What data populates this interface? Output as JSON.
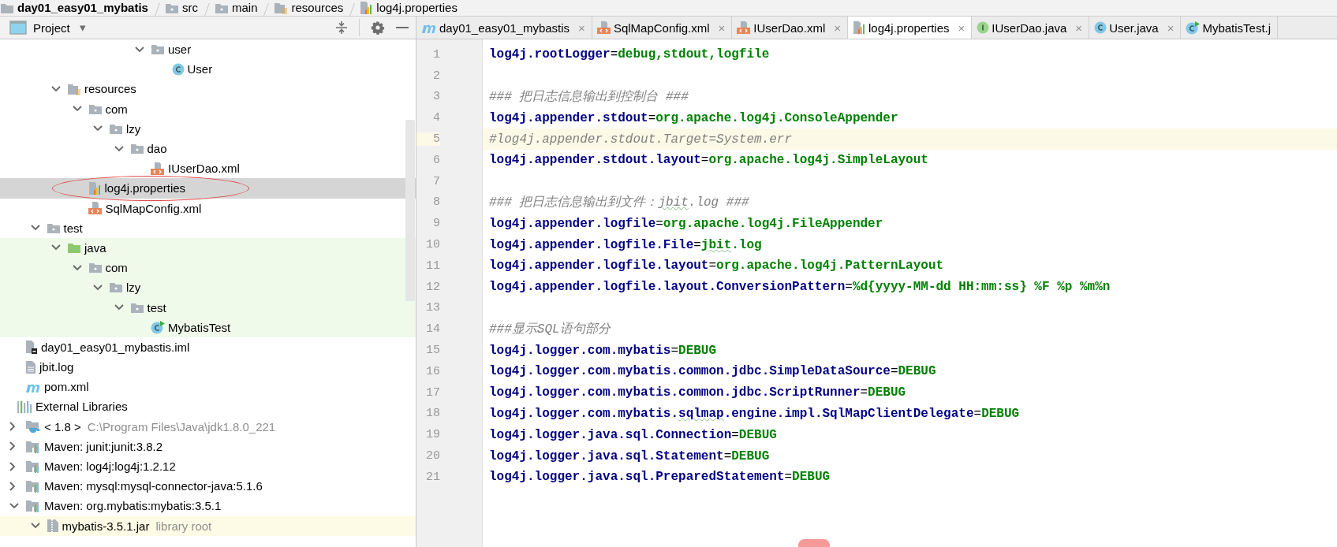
{
  "breadcrumb": [
    {
      "label": "day01_easy01_mybatis",
      "kind": "project"
    },
    {
      "label": "src",
      "kind": "folder"
    },
    {
      "label": "main",
      "kind": "folder"
    },
    {
      "label": "resources",
      "kind": "resource-folder"
    },
    {
      "label": "log4j.properties",
      "kind": "properties"
    }
  ],
  "project_panel": {
    "title": "Project",
    "caret": "▾",
    "tree": [
      {
        "children": [
          {
            "children": [
              {
                "children": [
                  {
                    "children": [
                      {
                        "children": [
                          {
                            "children": [
                              {
                                "children": [
                                  {
                                    "label": "user",
                                    "kind": "folder",
                                    "expanded": true,
                                    "selected": false,
                                    "children": [
                                      {
                                        "label": "User",
                                        "kind": "class",
                                        "selected": false
                                      }
                                    ]
                                  }
                                ]
                              }
                            ]
                          }
                        ]
                      }
                    ]
                  },
                  {
                    "label": "resources",
                    "kind": "resource-folder",
                    "expanded": true,
                    "selected": false,
                    "children": [
                      {
                        "label": "com",
                        "kind": "folder",
                        "expanded": true,
                        "selected": false,
                        "children": [
                          {
                            "label": "lzy",
                            "kind": "folder",
                            "expanded": true,
                            "selected": false,
                            "children": [
                              {
                                "label": "dao",
                                "kind": "folder",
                                "expanded": true,
                                "selected": false,
                                "children": [
                                  {
                                    "label": "IUserDao.xml",
                                    "kind": "xml",
                                    "selected": false
                                  }
                                ]
                              }
                            ]
                          }
                        ]
                      },
                      {
                        "label": "log4j.properties",
                        "kind": "properties",
                        "selected": true,
                        "circled": true
                      },
                      {
                        "label": "SqlMapConfig.xml",
                        "kind": "xml",
                        "selected": false
                      }
                    ]
                  }
                ]
              },
              {
                "label": "test",
                "kind": "folder",
                "expanded": true,
                "selected": false,
                "children": [
                  {
                    "label": "java",
                    "kind": "test-folder",
                    "test_scope": true,
                    "expanded": true,
                    "selected": false,
                    "children": [
                      {
                        "label": "com",
                        "kind": "folder",
                        "expanded": true,
                        "selected": false,
                        "children": [
                          {
                            "label": "lzy",
                            "kind": "folder",
                            "expanded": true,
                            "selected": false,
                            "children": [
                              {
                                "label": "test",
                                "kind": "folder",
                                "expanded": true,
                                "selected": false,
                                "children": [
                                  {
                                    "label": "MybatisTest",
                                    "kind": "test-class",
                                    "selected": false
                                  }
                                ]
                              }
                            ]
                          }
                        ]
                      }
                    ]
                  }
                ]
              }
            ]
          },
          {
            "label": "day01_easy01_mybastis.iml",
            "kind": "iml",
            "selected": false
          },
          {
            "label": "jbit.log",
            "kind": "log",
            "selected": false
          },
          {
            "label": "pom.xml",
            "kind": "maven",
            "selected": false
          }
        ]
      },
      {
        "label": "External Libraries",
        "kind": "libraries",
        "selected": false,
        "children": [
          {
            "label": "< 1.8 >",
            "detail": "C:\\Program Files\\Java\\jdk1.8.0_221",
            "kind": "jdk",
            "expanded": false,
            "selected": false
          },
          {
            "label": "Maven: junit:junit:3.8.2",
            "kind": "maven-library",
            "expanded": false,
            "selected": false
          },
          {
            "label": "Maven: log4j:log4j:1.2.12",
            "kind": "maven-library",
            "expanded": false,
            "selected": false
          },
          {
            "label": "Maven: mysql:mysql-connector-java:5.1.6",
            "kind": "maven-library",
            "expanded": false,
            "selected": false
          },
          {
            "label": "Maven: org.mybatis:mybatis:3.5.1",
            "kind": "maven-library",
            "expanded": true,
            "selected": false,
            "children": [
              {
                "label": "mybatis-3.5.1.jar",
                "detail": "library root",
                "kind": "jar",
                "library_scope": true,
                "expanded": true,
                "selected": false
              }
            ]
          }
        ]
      }
    ]
  },
  "editor": {
    "tabs": [
      {
        "label": "day01_easy01_mybastis",
        "kind": "maven",
        "selected": false,
        "close": "×"
      },
      {
        "label": "SqlMapConfig.xml",
        "kind": "xml",
        "selected": false,
        "close": "×"
      },
      {
        "label": "IUserDao.xml",
        "kind": "xml",
        "selected": false,
        "close": "×"
      },
      {
        "label": "log4j.properties",
        "kind": "properties",
        "selected": true,
        "close": "×"
      },
      {
        "label": "IUserDao.java",
        "kind": "interface",
        "selected": false,
        "close": "×"
      },
      {
        "label": "User.java",
        "kind": "class",
        "selected": false,
        "close": "×"
      },
      {
        "label": "MybatisTest.j",
        "kind": "test-class",
        "selected": false
      }
    ],
    "lines": [
      {
        "number": "1",
        "current": false,
        "segments": [
          {
            "kind": "key",
            "text": "log4j.rootLogger"
          },
          {
            "kind": "op",
            "text": "="
          },
          {
            "kind": "value",
            "text": "debug,stdout,logfile"
          }
        ]
      },
      {
        "number": "2",
        "current": false
      },
      {
        "number": "3",
        "current": false,
        "segments": [
          {
            "kind": "comment",
            "text": "### 把日志信息输出到控制台 ###"
          }
        ]
      },
      {
        "number": "4",
        "current": false,
        "segments": [
          {
            "kind": "key",
            "text": "log4j.appender.stdout"
          },
          {
            "kind": "op",
            "text": "="
          },
          {
            "kind": "value",
            "text": "org.apache.log4j.ConsoleAppender"
          }
        ]
      },
      {
        "number": "5",
        "current": true,
        "segments": [
          {
            "kind": "comment",
            "text": "#log4j.appender.stdout.Target=System.err"
          }
        ]
      },
      {
        "number": "6",
        "current": false,
        "segments": [
          {
            "kind": "key",
            "text": "log4j.appender.stdout.layout"
          },
          {
            "kind": "op",
            "text": "="
          },
          {
            "kind": "value",
            "text": "org.apache.log4j.SimpleLayout"
          }
        ]
      },
      {
        "number": "7",
        "current": false
      },
      {
        "number": "8",
        "current": false,
        "segments": [
          {
            "kind": "comment",
            "text": "### 把日志信息输出到文件："
          },
          {
            "kind": "comment",
            "text": "jbit",
            "spellcheck": true
          },
          {
            "kind": "comment",
            "text": ".log ###"
          }
        ]
      },
      {
        "number": "9",
        "current": false,
        "segments": [
          {
            "kind": "key",
            "text": "log4j.appender.logfile"
          },
          {
            "kind": "op",
            "text": "="
          },
          {
            "kind": "value",
            "text": "org.apache.log4j.FileAppender"
          }
        ]
      },
      {
        "number": "10",
        "current": false,
        "segments": [
          {
            "kind": "key",
            "text": "log4j.appender.logfile.File"
          },
          {
            "kind": "op",
            "text": "="
          },
          {
            "kind": "value",
            "text": "jbit",
            "spellcheck": true
          },
          {
            "kind": "value",
            "text": ".log"
          }
        ]
      },
      {
        "number": "11",
        "current": false,
        "segments": [
          {
            "kind": "key",
            "text": "log4j.appender.logfile.layout"
          },
          {
            "kind": "op",
            "text": "="
          },
          {
            "kind": "value",
            "text": "org.apache.log4j.PatternLayout"
          }
        ]
      },
      {
        "number": "12",
        "current": false,
        "segments": [
          {
            "kind": "key",
            "text": "log4j.appender.logfile.layout.ConversionPattern"
          },
          {
            "kind": "op",
            "text": "="
          },
          {
            "kind": "value",
            "text": "%d{yyyy-MM-dd HH:mm:ss} %F %p %m%n"
          }
        ]
      },
      {
        "number": "13",
        "current": false
      },
      {
        "number": "14",
        "current": false,
        "segments": [
          {
            "kind": "comment",
            "text": "###显示SQL语句部分"
          }
        ]
      },
      {
        "number": "15",
        "current": false,
        "segments": [
          {
            "kind": "key",
            "text": "log4j.logger.com.mybatis"
          },
          {
            "kind": "op",
            "text": "="
          },
          {
            "kind": "value",
            "text": "DEBUG"
          }
        ]
      },
      {
        "number": "16",
        "current": false,
        "segments": [
          {
            "kind": "key",
            "text": "log4j.logger.com.mybatis.common.jdbc.SimpleDataSource"
          },
          {
            "kind": "op",
            "text": "="
          },
          {
            "kind": "value",
            "text": "DEBUG"
          }
        ]
      },
      {
        "number": "17",
        "current": false,
        "segments": [
          {
            "kind": "key",
            "text": "log4j.logger.com.mybatis.common.jdbc.ScriptRunner"
          },
          {
            "kind": "op",
            "text": "="
          },
          {
            "kind": "value",
            "text": "DEBUG"
          }
        ]
      },
      {
        "number": "18",
        "current": false,
        "segments": [
          {
            "kind": "key",
            "text": "log4j.logger.com.mybatis."
          },
          {
            "kind": "key",
            "text": "sqlmap",
            "spellcheck": true
          },
          {
            "kind": "key",
            "text": ".engine.impl.SqlMapClientDelegate"
          },
          {
            "kind": "op",
            "text": "="
          },
          {
            "kind": "value",
            "text": "DEBUG"
          }
        ]
      },
      {
        "number": "19",
        "current": false,
        "segments": [
          {
            "kind": "key",
            "text": "log4j.logger.java.sql.Connection"
          },
          {
            "kind": "op",
            "text": "="
          },
          {
            "kind": "value",
            "text": "DEBUG"
          }
        ]
      },
      {
        "number": "20",
        "current": false,
        "segments": [
          {
            "kind": "key",
            "text": "log4j.logger.java.sql.Statement"
          },
          {
            "kind": "op",
            "text": "="
          },
          {
            "kind": "value",
            "text": "DEBUG"
          }
        ]
      },
      {
        "number": "21",
        "current": false,
        "segments": [
          {
            "kind": "key",
            "text": "log4j.logger.java.sql.PreparedStatement"
          },
          {
            "kind": "op",
            "text": "="
          },
          {
            "kind": "value",
            "text": "DEBUG"
          }
        ]
      }
    ],
    "overlay": {
      "kind": "pill"
    }
  }
}
